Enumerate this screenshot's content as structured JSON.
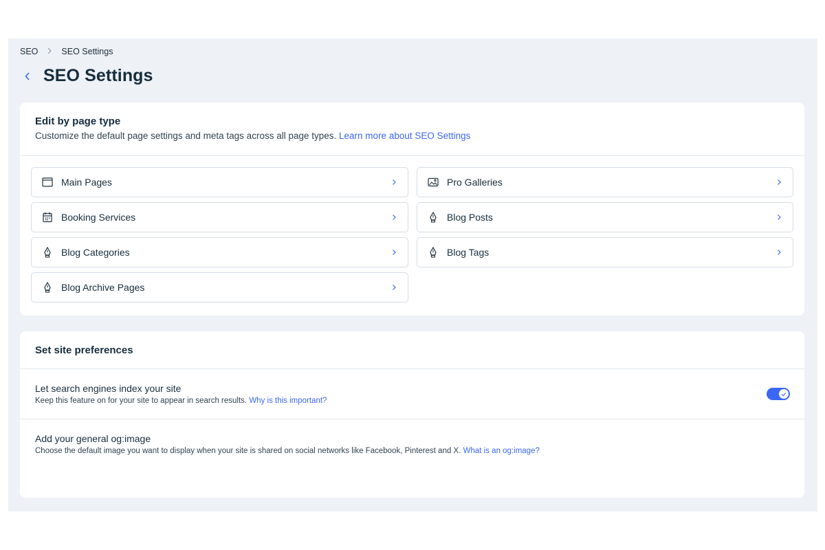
{
  "breadcrumb": {
    "root": "SEO",
    "current": "SEO Settings"
  },
  "header": {
    "title": "SEO Settings"
  },
  "edit_section": {
    "title": "Edit by page type",
    "description": "Customize the default page settings and meta tags across all page types.",
    "learn_more": "Learn more about SEO Settings",
    "items": [
      {
        "label": "Main Pages",
        "icon": "page-icon"
      },
      {
        "label": "Pro Galleries",
        "icon": "gallery-icon"
      },
      {
        "label": "Booking Services",
        "icon": "calendar-icon"
      },
      {
        "label": "Blog Posts",
        "icon": "pen-nib-icon"
      },
      {
        "label": "Blog Categories",
        "icon": "pen-nib-icon"
      },
      {
        "label": "Blog Tags",
        "icon": "pen-nib-icon"
      },
      {
        "label": "Blog Archive Pages",
        "icon": "pen-nib-icon"
      }
    ]
  },
  "prefs_section": {
    "title": "Set site preferences",
    "index": {
      "title": "Let search engines index your site",
      "description": "Keep this feature on for your site to appear in search results.",
      "link": "Why is this important?",
      "enabled": true
    },
    "og_image": {
      "title": "Add your general og:image",
      "description": "Choose the default image you want to display when your site is shared on social networks like Facebook, Pinterest and X.",
      "link": "What is an og:image?"
    }
  },
  "colors": {
    "accent": "#3b67f5",
    "background": "#eef1f6",
    "text": "#162d3d"
  }
}
